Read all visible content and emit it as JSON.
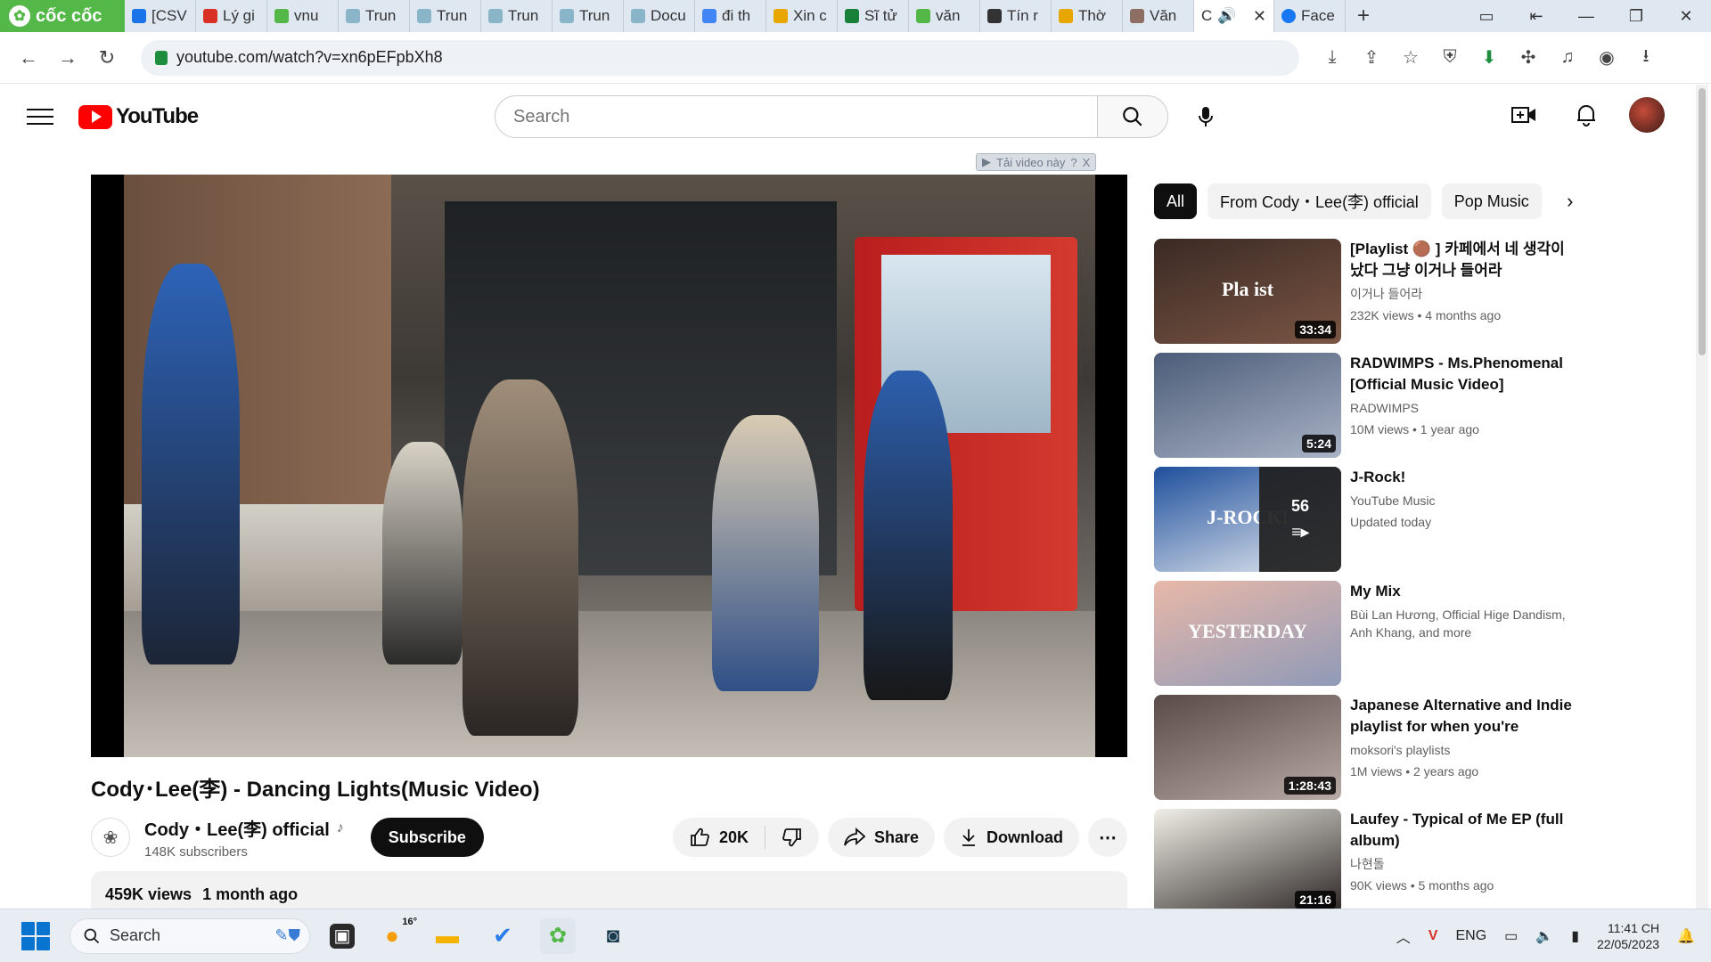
{
  "browser": {
    "brand": "cốc cốc",
    "tabs": [
      {
        "label": "[CSV",
        "color": "#1a73e8"
      },
      {
        "label": "Lý gi",
        "color": "#d93025"
      },
      {
        "label": "vnu",
        "color": "#53b848"
      },
      {
        "label": "Trun",
        "color": "#8ab4c8"
      },
      {
        "label": "Trun",
        "color": "#8ab4c8"
      },
      {
        "label": "Trun",
        "color": "#8ab4c8"
      },
      {
        "label": "Trun",
        "color": "#8ab4c8"
      },
      {
        "label": "Docu",
        "color": "#8ab4c8"
      },
      {
        "label": "đi th",
        "color": "#4285f4"
      },
      {
        "label": "Xin c",
        "color": "#e8a600"
      },
      {
        "label": "Sĩ tử",
        "color": "#188038"
      },
      {
        "label": "văn",
        "color": "#53b848"
      },
      {
        "label": "Tín r",
        "color": "#333333"
      },
      {
        "label": "Thờ",
        "color": "#e8a600"
      },
      {
        "label": "Văn",
        "color": "#8d6e63"
      }
    ],
    "active_tab": {
      "label": "C",
      "audio_icon": "speaker-icon",
      "close": "✕"
    },
    "after_tab": {
      "label": "Face",
      "color": "#1877f2"
    },
    "new_tab": "+",
    "url": "youtube.com/watch?v=xn6pEFpbXh8"
  },
  "youtube": {
    "logo_text": "YouTube",
    "search_placeholder": "Search",
    "brand_color": "#ff0000"
  },
  "player": {
    "ad_badge": "Tải video này",
    "ad_help": "?",
    "ad_close": "X"
  },
  "video": {
    "title": "Cody･Lee(李) - Dancing Lights(Music Video)",
    "channel": "Cody・Lee(李) official",
    "subscribers": "148K subscribers",
    "subscribe_label": "Subscribe",
    "likes": "20K",
    "share_label": "Share",
    "download_label": "Download",
    "views": "459K views",
    "age": "1 month ago"
  },
  "chips": [
    "All",
    "From Cody・Lee(李) official",
    "Pop Music"
  ],
  "recommendations": [
    {
      "title": "[Playlist 🟤 ] 카페에서 네 생각이 났다 그냥 이거나 들어라",
      "channel": "이거나 들어라",
      "stats": "232K views  •  4 months ago",
      "duration": "33:34",
      "thumb_text": "Pla  ist",
      "thumb_colors": [
        "#3a2a24",
        "#7a5544"
      ]
    },
    {
      "title": "RADWIMPS - Ms.Phenomenal [Official Music Video]",
      "channel": "RADWIMPS",
      "stats": "10M views  •  1 year ago",
      "duration": "5:24",
      "thumb_text": "",
      "thumb_colors": [
        "#4c5c78",
        "#a9b3c6"
      ]
    },
    {
      "title": "J-Rock!",
      "channel": "YouTube Music",
      "stats": "Updated today",
      "duration": "",
      "thumb_text": "J-ROCK!",
      "thumb_colors": [
        "#1e4f9c",
        "#e8ecf1"
      ],
      "playlist_count": "56"
    },
    {
      "title": "My Mix",
      "channel": "Bùi Lan Hương, Official Hige Dandism, Anh Khang, and more",
      "stats": "",
      "duration": "",
      "thumb_text": "YESTERDAY",
      "thumb_colors": [
        "#e8b8a8",
        "#8f9ab8"
      ]
    },
    {
      "title": "Japanese Alternative and Indie playlist for when you're runnin...",
      "channel": "moksori's playlists",
      "stats": "1M views  •  2 years ago",
      "duration": "1:28:43",
      "thumb_text": "",
      "thumb_colors": [
        "#5a4a48",
        "#b8aaa4"
      ]
    },
    {
      "title": "Laufey - Typical of Me EP (full album)",
      "channel": "나현돌",
      "stats": "90K views  •  5 months ago",
      "duration": "21:16",
      "thumb_text": "",
      "thumb_colors": [
        "#f1efe8",
        "#2b2523"
      ]
    }
  ],
  "taskbar": {
    "search_label": "Search",
    "weather": "16°",
    "lang": "ENG",
    "time": "11:41 CH",
    "date": "22/05/2023"
  }
}
